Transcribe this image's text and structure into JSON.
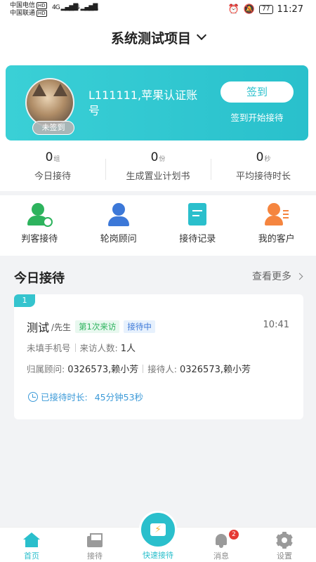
{
  "status_bar": {
    "carrier1": "中国电信",
    "carrier2": "中国联通",
    "hd": "HD",
    "net1": "4G",
    "net2": "4G",
    "battery": "77",
    "time": "11:27"
  },
  "header": {
    "title": "系统测试项目"
  },
  "profile": {
    "badge": "未签到",
    "account": "L111111,苹果认证账号",
    "signin_button": "签到",
    "signin_hint": "签到开始接待"
  },
  "stats": [
    {
      "value": "0",
      "unit": "组",
      "label": "今日接待"
    },
    {
      "value": "0",
      "unit": "份",
      "label": "生成置业计划书"
    },
    {
      "value": "0",
      "unit": "秒",
      "label": "平均接待时长"
    }
  ],
  "actions": [
    {
      "label": "判客接待",
      "icon": "user-check-icon",
      "color": "#2db35d"
    },
    {
      "label": "轮岗顾问",
      "icon": "consultant-icon",
      "color": "#3c78d8"
    },
    {
      "label": "接待记录",
      "icon": "record-doc-icon",
      "color": "#2abfcc"
    },
    {
      "label": "我的客户",
      "icon": "customers-icon",
      "color": "#f5853f"
    }
  ],
  "today": {
    "title": "今日接待",
    "view_more": "查看更多",
    "card": {
      "index": "1",
      "name": "测试",
      "title": "/先生",
      "tag_visit": "第1次来访",
      "tag_status": "接待中",
      "time": "10:41",
      "phone": "未填手机号",
      "visitors_label": "来访人数:",
      "visitors_value": "1人",
      "consultant_label": "归属顾问:",
      "consultant_value": "0326573,赖小芳",
      "receptionist_label": "接待人:",
      "receptionist_value": "0326573,赖小芳",
      "duration_label": "已接待时长:",
      "duration_value": "45分钟53秒"
    }
  },
  "nav": {
    "home": "首页",
    "reception": "接待",
    "quick": "快速接待",
    "messages": "消息",
    "messages_badge": "2",
    "settings": "设置"
  },
  "colors": {
    "accent": "#2abfcc",
    "green": "#2db35d",
    "blue": "#3c78d8",
    "orange": "#f5853f"
  }
}
